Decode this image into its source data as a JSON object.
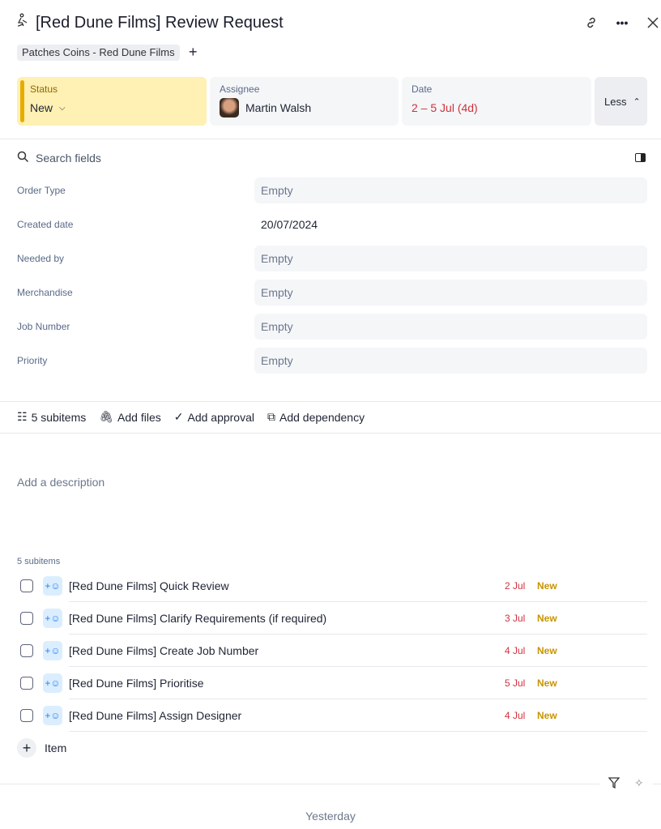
{
  "header": {
    "title": "[Red Dune Films] Review Request",
    "tag": "Patches Coins - Red Dune Films"
  },
  "cards": {
    "status_label": "Status",
    "status_value": "New",
    "assignee_label": "Assignee",
    "assignee_value": "Martin Walsh",
    "date_label": "Date",
    "date_value": "2 – 5 Jul (4d)",
    "less_label": "Less"
  },
  "search": {
    "placeholder": "Search fields"
  },
  "fields": [
    {
      "label": "Order Type",
      "value": "Empty"
    },
    {
      "label": "Created date",
      "value": "20/07/2024"
    },
    {
      "label": "Needed by",
      "value": "Empty"
    },
    {
      "label": "Merchandise",
      "value": "Empty"
    },
    {
      "label": "Job Number",
      "value": "Empty"
    },
    {
      "label": "Priority",
      "value": "Empty"
    }
  ],
  "toolbar": {
    "subitems": "5 subitems",
    "files": "Add files",
    "approval": "Add approval",
    "dependency": "Add dependency"
  },
  "description_placeholder": "Add a description",
  "subitems": {
    "heading": "5 subitems",
    "items": [
      {
        "name": "[Red Dune Films] Quick Review",
        "date": "2 Jul",
        "status": "New"
      },
      {
        "name": "[Red Dune Films] Clarify Requirements (if required)",
        "date": "3 Jul",
        "status": "New"
      },
      {
        "name": "[Red Dune Films] Create Job Number",
        "date": "4 Jul",
        "status": "New"
      },
      {
        "name": "[Red Dune Films] Prioritise",
        "date": "5 Jul",
        "status": "New"
      },
      {
        "name": "[Red Dune Films] Assign Designer",
        "date": "4 Jul",
        "status": "New"
      }
    ],
    "add_label": "Item"
  },
  "activity": {
    "day": "Yesterday"
  }
}
